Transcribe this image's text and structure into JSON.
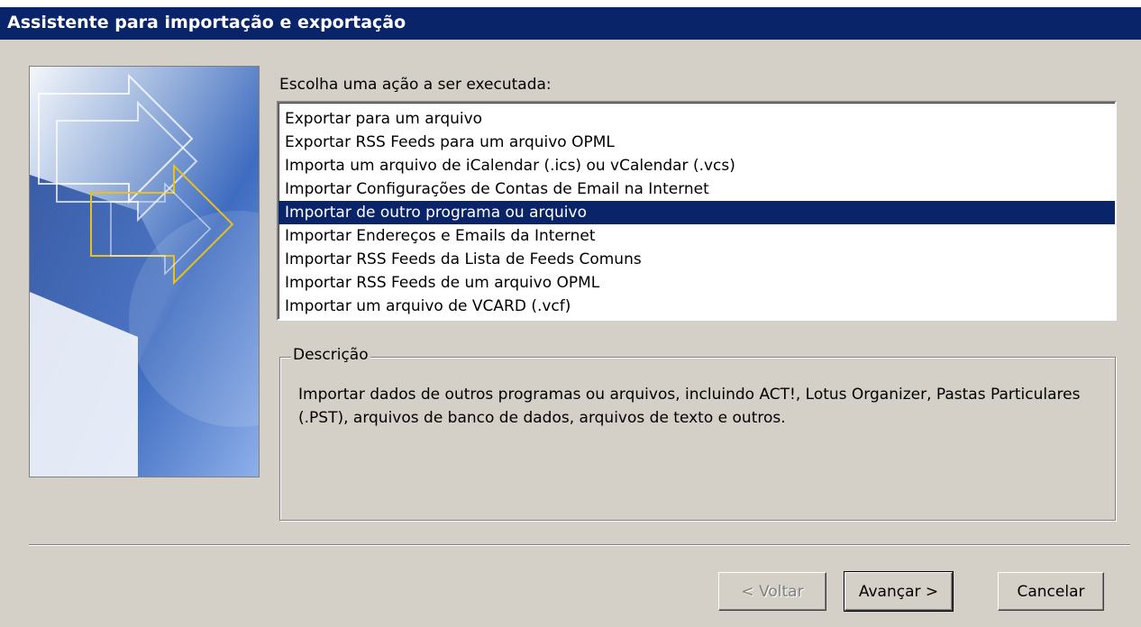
{
  "window": {
    "title": "Assistente para importação e exportação"
  },
  "main": {
    "prompt": "Escolha uma ação a ser executada:",
    "actions": [
      "Exportar para um arquivo",
      "Exportar RSS Feeds para um arquivo OPML",
      "Importa um arquivo de iCalendar (.ics) ou vCalendar (.vcs)",
      "Importar Configurações de Contas de Email na Internet",
      "Importar de outro programa ou arquivo",
      "Importar Endereços e Emails da Internet",
      "Importar RSS Feeds da Lista de Feeds Comuns",
      "Importar RSS Feeds de um arquivo OPML",
      "Importar um arquivo de VCARD (.vcf)"
    ],
    "selected_index": 4,
    "description_label": "Descrição",
    "description_text": "Importar dados de outros programas ou arquivos, incluindo ACT!, Lotus Organizer, Pastas Particulares (.PST), arquivos de banco de dados, arquivos de texto e outros."
  },
  "buttons": {
    "back": "< Voltar",
    "next": "Avançar >",
    "cancel": "Cancelar"
  },
  "colors": {
    "dialog_bg": "#d4d0c8",
    "title_bg": "#0a246a",
    "selection": "#0a246a"
  }
}
